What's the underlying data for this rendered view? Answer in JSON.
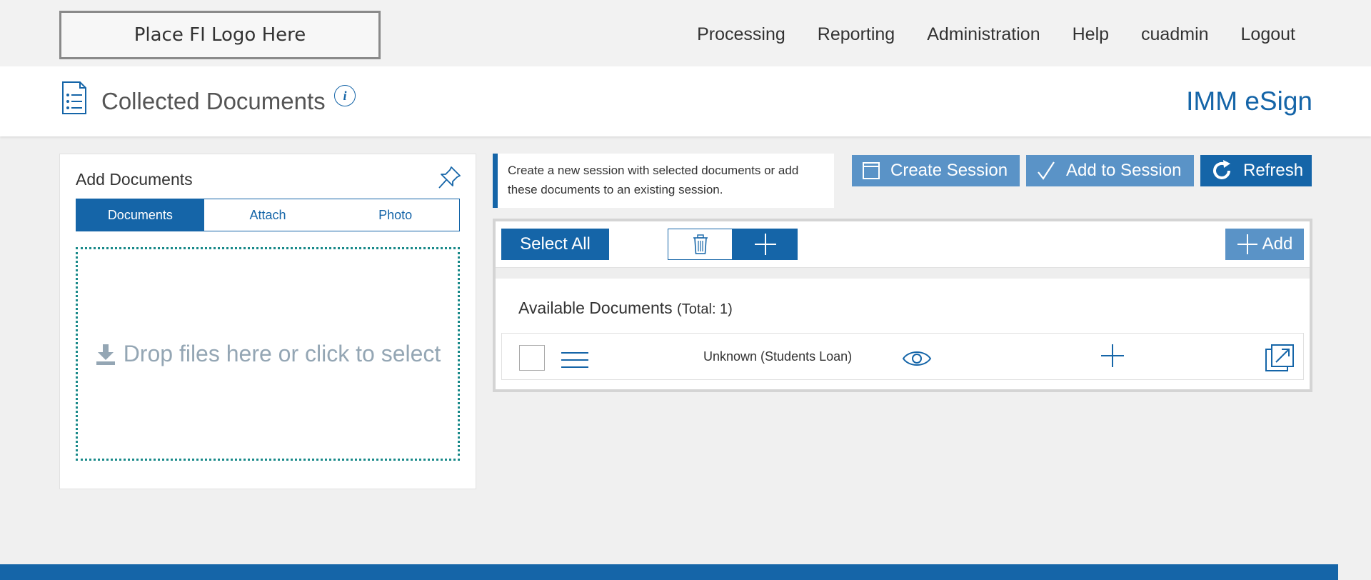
{
  "header": {
    "logo_text": "Place FI Logo Here",
    "nav": [
      {
        "label": "Processing"
      },
      {
        "label": "Reporting"
      },
      {
        "label": "Administration"
      },
      {
        "label": "Help"
      },
      {
        "label": "cuadmin"
      },
      {
        "label": "Logout"
      }
    ]
  },
  "page": {
    "title": "Collected Documents",
    "info_glyph": "i",
    "brand": "IMM eSign"
  },
  "add_documents": {
    "title": "Add Documents",
    "tabs": [
      {
        "label": "Documents",
        "active": true
      },
      {
        "label": "Attach",
        "active": false
      },
      {
        "label": "Photo",
        "active": false
      }
    ],
    "dropzone_text": "Drop files here or click to select"
  },
  "session": {
    "notice": "Create a new session with selected documents or add these documents to an existing session.",
    "create_label": "Create Session",
    "add_label": "Add to Session",
    "refresh_label": "Refresh"
  },
  "documents_panel": {
    "select_all_label": "Select All",
    "add_label": "Add",
    "available_title": "Available Documents",
    "total_text": "(Total: 1)",
    "rows": [
      {
        "name": "Unknown (Students Loan)"
      }
    ]
  },
  "colors": {
    "primary": "#1565a8",
    "secondary": "#5a93c7",
    "dropzone_border": "#1a8a8a"
  }
}
